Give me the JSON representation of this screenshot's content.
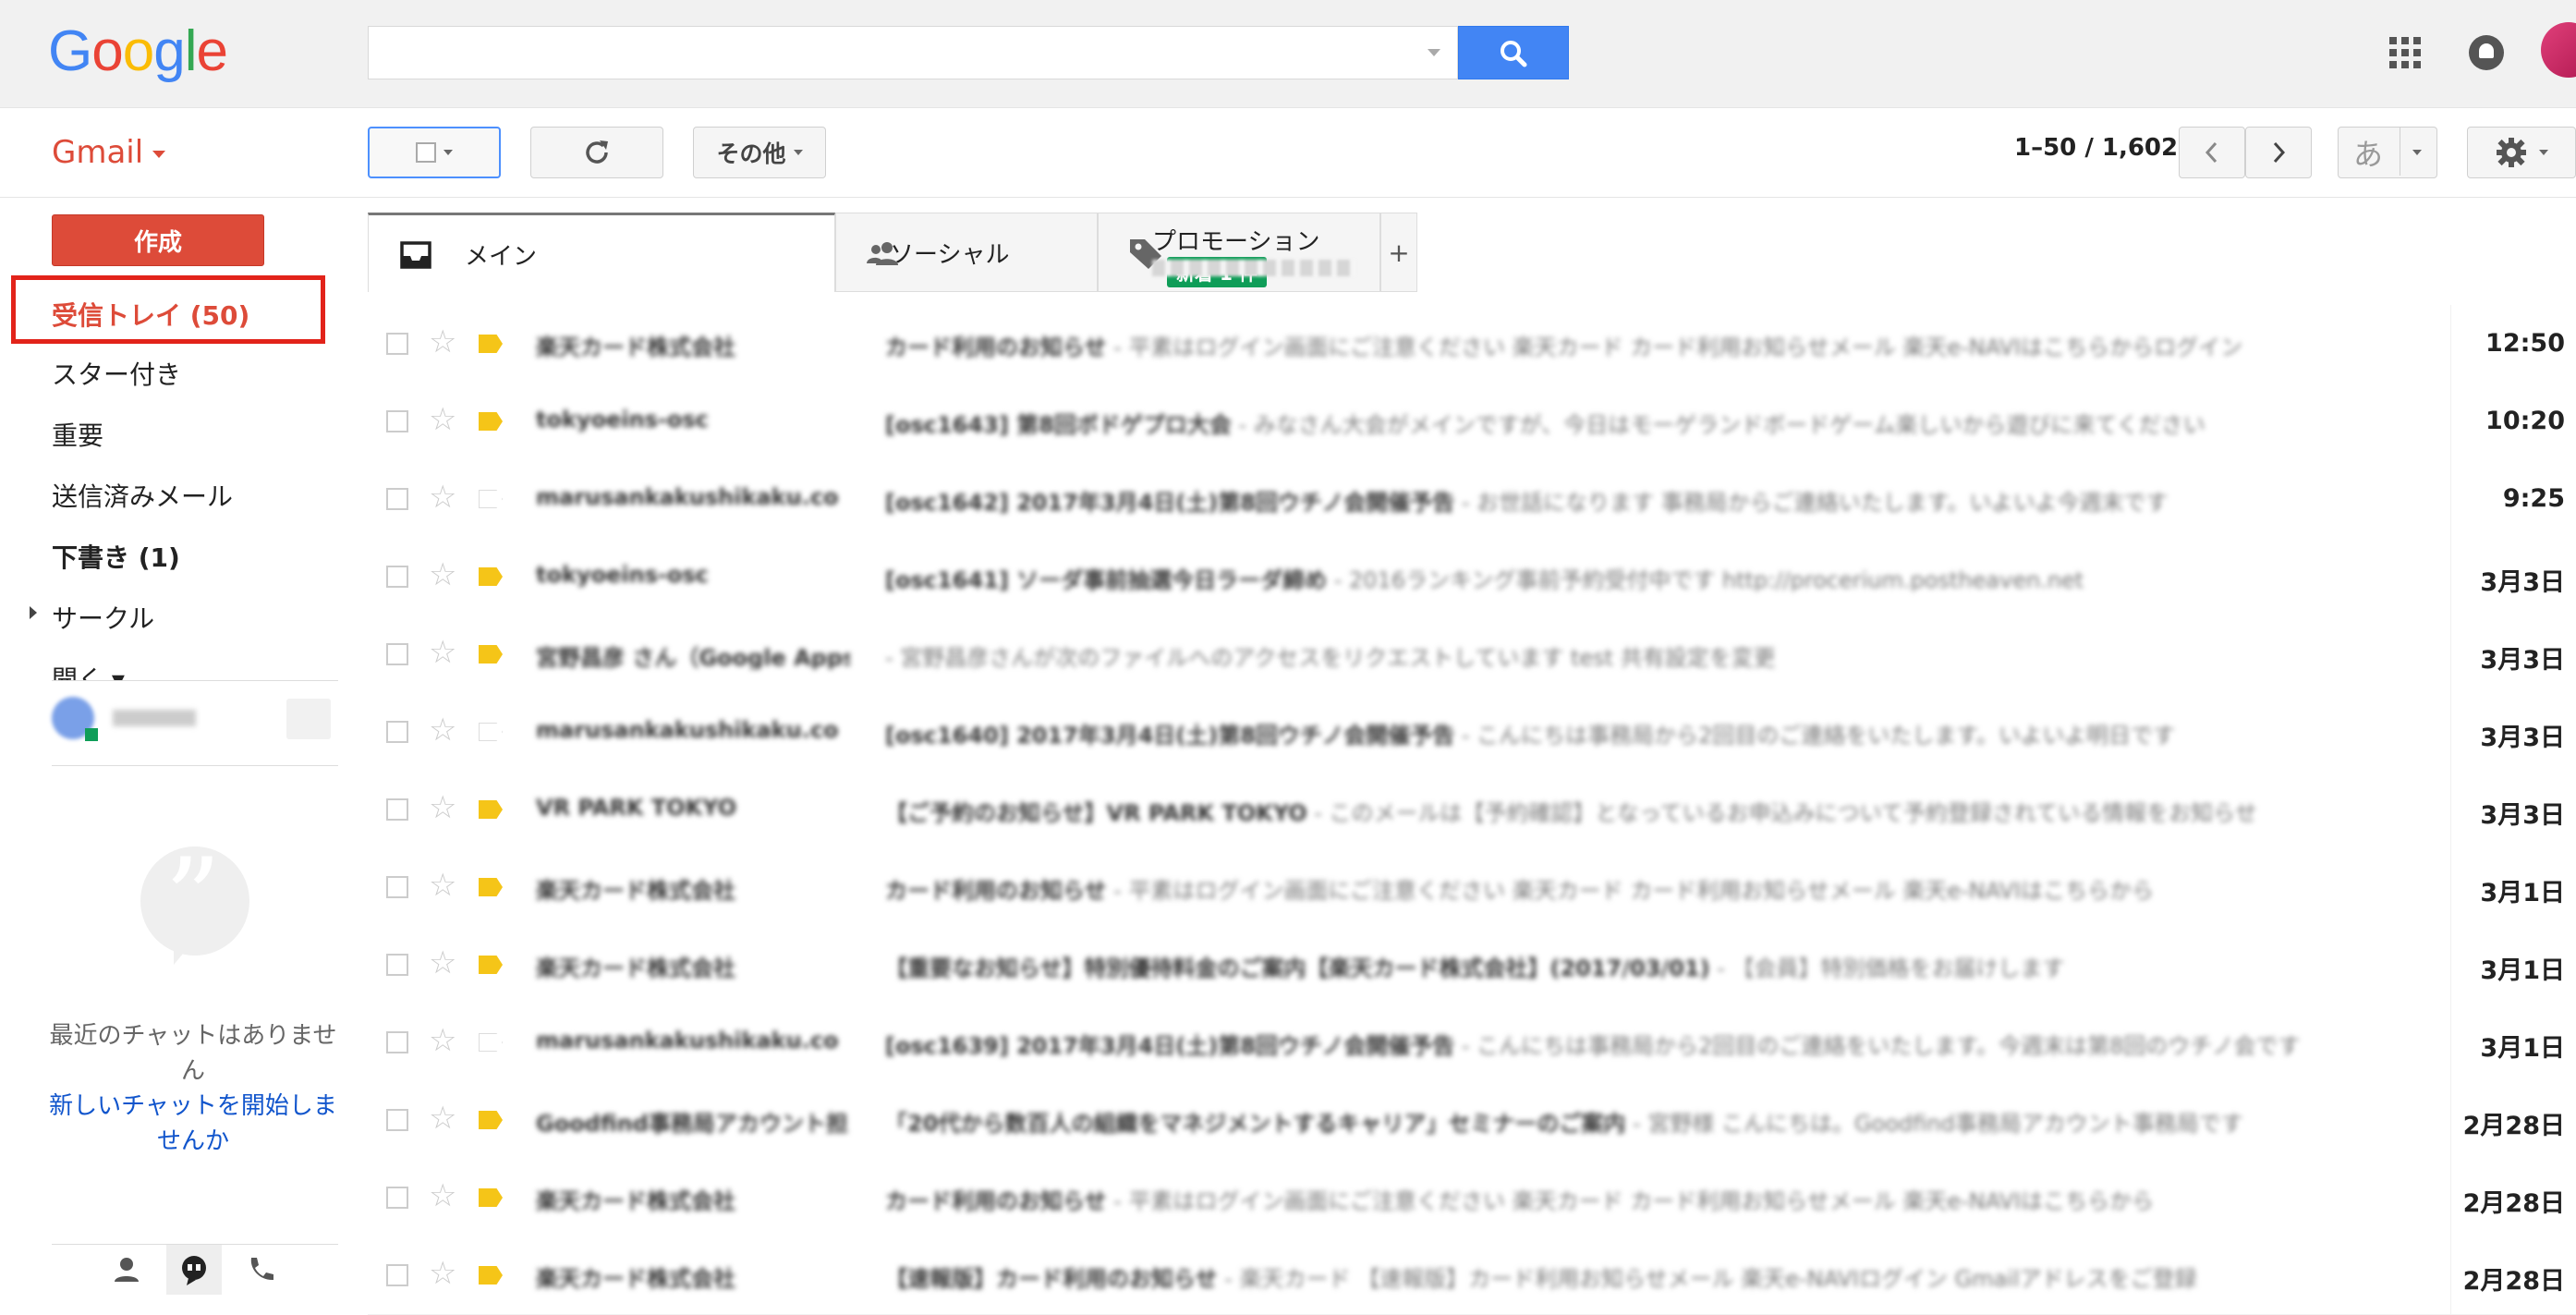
{
  "header": {
    "logo_text": "Google",
    "search_value": "",
    "search_placeholder": ""
  },
  "toolbar": {
    "app_label": "Gmail",
    "more_label": "その他",
    "page_range": "1–50 / 1,602",
    "input_tool_label": "あ"
  },
  "sidebar": {
    "compose_label": "作成",
    "items": [
      {
        "label": "受信トレイ (50)"
      },
      {
        "label": "スター付き"
      },
      {
        "label": "重要"
      },
      {
        "label": "送信済みメール"
      },
      {
        "label": "下書き (1)"
      },
      {
        "label": "サークル"
      },
      {
        "label": "開く ▾"
      }
    ],
    "chat_empty": "最近のチャットはありません",
    "chat_new_link": "新しいチャットを開始しませんか"
  },
  "tabs": [
    {
      "label": "メイン",
      "icon": "inbox-icon"
    },
    {
      "label": "ソーシャル",
      "icon": "people-icon"
    },
    {
      "label": "プロモーション",
      "icon": "tag-icon",
      "badge": "新着 1 件"
    }
  ],
  "emails": [
    {
      "sender": "楽天カード株式会社",
      "subject": "カード利用のお知らせ",
      "snippet": " - 平素はログイン画面にご注意ください 楽天カード カード利用お知らせメール 楽天e-NAVIはこちらからログイン",
      "date": "12:50",
      "important": true
    },
    {
      "sender": "tokyoeins-osc",
      "subject": "[osc1643] 第8回ボドゲプロ大会",
      "snippet": " - みなさん大会がメインですが、今日はモーゲランドボードゲーム楽しいから遊びに来てください",
      "date": "10:20",
      "important": true
    },
    {
      "sender": "marusankakushikaku.co",
      "subject": "[osc1642] 2017年3月4日(土)第8回ウチノ会開催予告",
      "snippet": " - お世話になります 事務局からご連絡いたします。いよいよ今週末です",
      "date": "9:25",
      "important": false
    },
    {
      "sender": "tokyoeins-osc",
      "subject": "[osc1641] ソーダ事前抽選今日ラーダ締め",
      "snippet": " - 2016ランキング事前予約受付中です http://procerium.postheaven.net",
      "date": "3月3日",
      "important": true
    },
    {
      "sender": "宮野昌彦 さん（Google Apps test）- アクセス権のリクエスト",
      "subject": "",
      "snippet": " - 宮野昌彦さんが次のファイルへのアクセスをリクエストしています test 共有設定を変更",
      "date": "3月3日",
      "important": true
    },
    {
      "sender": "marusankakushikaku.co",
      "subject": "[osc1640] 2017年3月4日(土)第8回ウチノ会開催予告",
      "snippet": " - こんにちは事務局から2回目のご連絡をいたします。いよいよ明日です",
      "date": "3月3日",
      "important": false
    },
    {
      "sender": "VR PARK TOKYO",
      "subject": "【ご予約のお知らせ】VR PARK TOKYO",
      "snippet": " - このメールは【予約確認】となっているお申込みについて予約登録されている情報をお知らせ",
      "date": "3月3日",
      "important": true
    },
    {
      "sender": "楽天カード株式会社",
      "subject": "カード利用のお知らせ",
      "snippet": " - 平素はログイン画面にご注意ください 楽天カード カード利用お知らせメール 楽天e-NAVIはこちらから",
      "date": "3月1日",
      "important": true
    },
    {
      "sender": "楽天カード株式会社",
      "subject": "【重要なお知らせ】特別優待料金のご案内【楽天カード株式会社】(2017/03/01)",
      "snippet": " - 【会員】特別価格をお届けします",
      "date": "3月1日",
      "important": true
    },
    {
      "sender": "marusankakushikaku.co",
      "subject": "[osc1639] 2017年3月4日(土)第8回ウチノ会開催予告",
      "snippet": " - こんにちは事務局から2回目のご連絡をいたします。今週末は第8回のウチノ会です",
      "date": "3月1日",
      "important": false
    },
    {
      "sender": "Goodfind事務局アカウント担当",
      "subject": "「20代から数百人の組織をマネジメントするキャリア」セミナーのご案内",
      "snippet": " - 宮野様 こんにちは。Goodfind事務局アカウント事務局です",
      "date": "2月28日",
      "important": true
    },
    {
      "sender": "楽天カード株式会社",
      "subject": "カード利用のお知らせ",
      "snippet": " - 平素はログイン画面にご注意ください 楽天カード カード利用お知らせメール 楽天e-NAVIはこちらから",
      "date": "2月28日",
      "important": true
    },
    {
      "sender": "楽天カード株式会社",
      "subject": "【速報版】カード利用のお知らせ",
      "snippet": " - 楽天カード 【速報版】カード利用お知らせメール 楽天e-NAVIログイン Gmailアドレスをご登録",
      "date": "2月28日",
      "important": true
    }
  ],
  "colors": {
    "brand_red": "#dd4b39",
    "search_blue": "#4285f4",
    "badge_green": "#0f9d58",
    "important_yellow": "#f5c518"
  }
}
